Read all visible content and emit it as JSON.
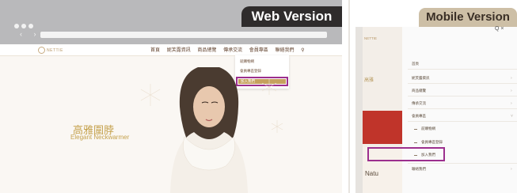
{
  "web": {
    "tag": "Web Version",
    "logo": "NETTIE",
    "nav": [
      "首頁",
      "妮芙露資訊",
      "商品總覽",
      "傳承交流",
      "會員專區",
      "聯絡我們"
    ],
    "dropdown": [
      "就購物網",
      "會員專區登錄",
      "加入我們"
    ],
    "hero_title": "高雅圍脖",
    "hero_subtitle": "Elegant Neckwarmer",
    "highlight_color": "#9c2f8e",
    "accent_color": "#c5a24d"
  },
  "mobile": {
    "tag": "Mobile Version",
    "close_icons": "Q ×",
    "logo": "NETTIE",
    "bg_text": "高雅",
    "bg_nat": "Natu",
    "menu": [
      "首頁",
      "妮芙露資訊",
      "商品總覽",
      "傳承交流",
      "會員專區"
    ],
    "submenu": [
      "前購物網",
      "會員專區登錄",
      "加入我們"
    ],
    "last_item": "聯絡我們"
  }
}
